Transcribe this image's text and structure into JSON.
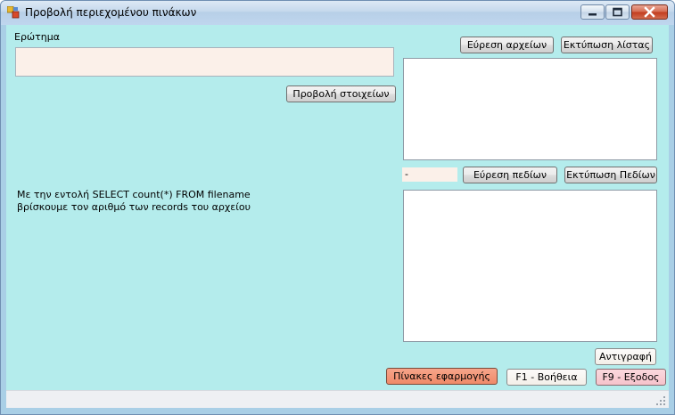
{
  "window": {
    "title": "Προβολή περιεχομένου πινάκων"
  },
  "query": {
    "label": "Ερώτημα",
    "value": ""
  },
  "buttons": {
    "find_files": "Εύρεση αρχείων",
    "print_list": "Εκτύπωση λίστας",
    "show_data": "Προβολή στοιχείων",
    "find_fields": "Εύρεση πεδίων",
    "print_fields": "Εκτύπωση Πεδίων",
    "copy": "Αντιγραφή",
    "app_tables": "Πίνακες εφαρμογής",
    "help": "F1 - Βοήθεια",
    "exit": "F9 - Εξοδος"
  },
  "fields_input": {
    "value": "-"
  },
  "hint": {
    "line1": "Με την εντολή SELECT count(*) FROM filename",
    "line2": "βρίσκουμε τον αριθμό των records του αρχείου"
  },
  "icons": {
    "app": "app-window-icon",
    "minimize": "minimize-icon",
    "maximize": "maximize-icon",
    "close": "close-icon",
    "grip": "size-grip-icon"
  },
  "colors": {
    "client_bg": "#b4ecec",
    "input_bg": "#fbf0e9",
    "app_tables_button": "#f08a69",
    "exit_button": "#f6c3cb"
  }
}
